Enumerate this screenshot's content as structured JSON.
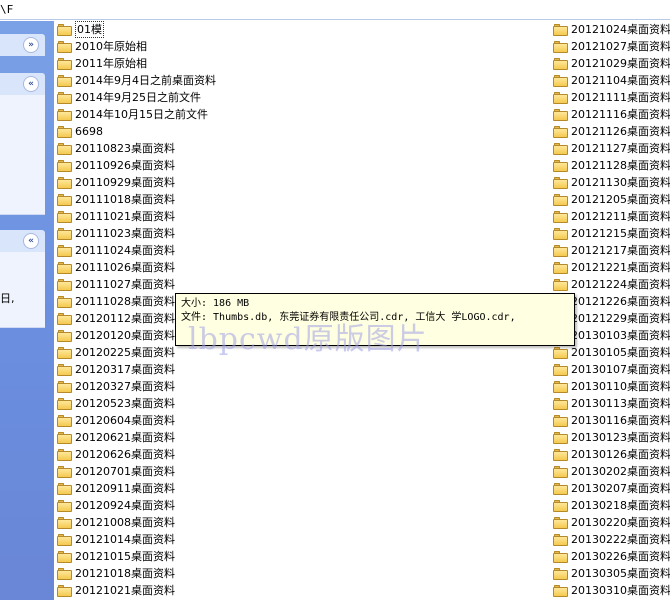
{
  "address_bar": {
    "text": "\\F"
  },
  "task_pane": {
    "chevron_collapse": "»",
    "chevron_expand": "«",
    "partial_text": "日,"
  },
  "left_column": [
    "01模",
    "2010年原始相",
    "2011年原始相",
    "2014年9月4日之前桌面资料",
    "2014年9月25日之前文件",
    "2014年10月15日之前文件",
    "6698",
    "20110823桌面资料",
    "20110926桌面资料",
    "20110929桌面资料",
    "20111018桌面资料",
    "20111021桌面资料",
    "20111023桌面资料",
    "20111024桌面资料",
    "20111026桌面资料",
    "20111027桌面资料",
    "20111028桌面资料",
    "20120112桌面资料",
    "20120120桌面资料",
    "20120225桌面资料",
    "20120317桌面资料",
    "20120327桌面资料",
    "20120523桌面资料",
    "20120604桌面资料",
    "20120621桌面资料",
    "20120626桌面资料",
    "20120701桌面资料",
    "20120911桌面资料",
    "20120924桌面资料",
    "20121008桌面资料",
    "20121014桌面资料",
    "20121015桌面资料",
    "20121018桌面资料",
    "20121021桌面资料"
  ],
  "right_column": [
    "20121024桌面资料",
    "20121027桌面资料",
    "20121029桌面资料",
    "20121104桌面资料",
    "20121111桌面资料",
    "20121116桌面资料",
    "20121126桌面资料",
    "20121127桌面资料",
    "20121128桌面资料",
    "20121130桌面资料",
    "20121205桌面资料",
    "20121211桌面资料",
    "20121215桌面资料",
    "20121217桌面资料",
    "20121221桌面资料",
    "20121224桌面资料",
    "20121226桌面资料",
    "20121229桌面资料",
    "20130103桌面资料",
    "20130105桌面资料",
    "20130107桌面资料",
    "20130110桌面资料",
    "20130113桌面资料",
    "20130116桌面资料",
    "20130123桌面资料",
    "20130126桌面资料",
    "20130202桌面资料",
    "20130207桌面资料",
    "20130218桌面资料",
    "20130220桌面资料",
    "20130222桌面资料",
    "20130226桌面资料",
    "20130305桌面资料",
    "20130310桌面资料"
  ],
  "tooltip": {
    "size_line": "大小: 186 MB",
    "files_line": "文件: Thumbs.db, 东莞证券有限责任公司.cdr, 工信大  学LOGO.cdr,"
  },
  "watermark": "lbpcwd原版图片"
}
